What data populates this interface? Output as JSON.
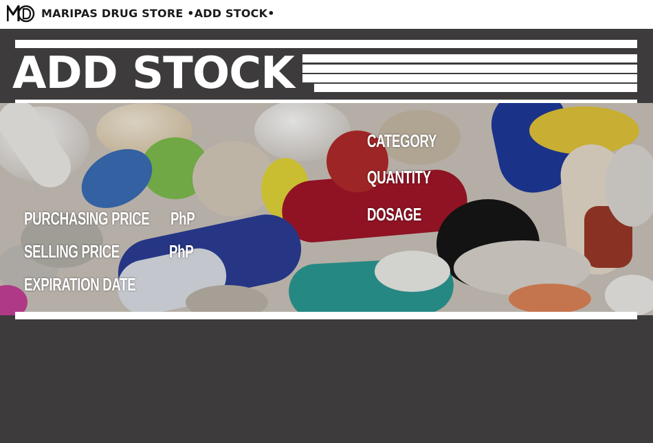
{
  "window": {
    "title": "MARIPAS DRUG STORE •ADD STOCK•",
    "logo_text": "MD"
  },
  "banner": {
    "heading": "ADD STOCK"
  },
  "form": {
    "purchasing_price_label": "PURCHASING PRICE",
    "purchasing_price_currency": "PhP",
    "selling_price_label": "SELLING PRICE",
    "selling_price_currency": "PhP",
    "expiration_date_label": "EXPIRATION DATE",
    "category_label": "CATEGORY",
    "quantity_label": "QUANTITY",
    "dosage_label": "DOSAGE"
  },
  "colors": {
    "background": "#3d3b3c",
    "banner_text": "#ffffff",
    "form_text": "#ffffff"
  }
}
